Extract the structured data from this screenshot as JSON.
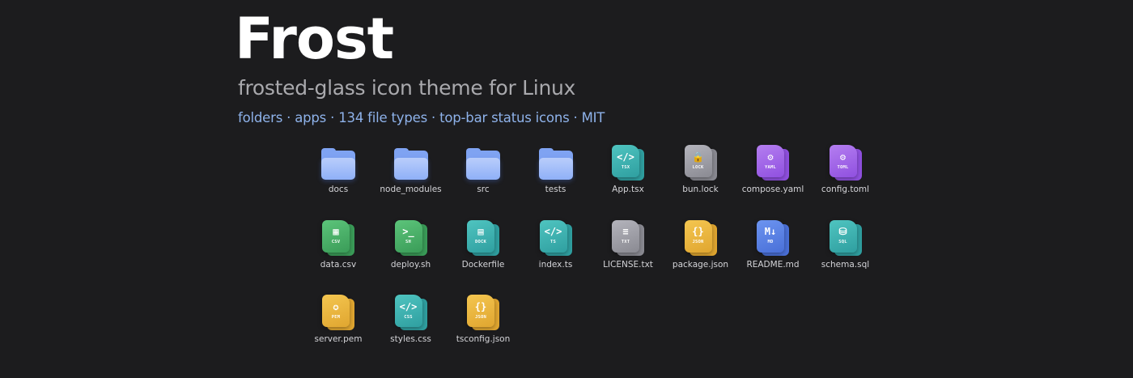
{
  "header": {
    "title": "Frost",
    "subtitle": "frosted-glass icon theme for Linux",
    "features": "folders · apps · 134 file types · top-bar status icons · MIT"
  },
  "items": [
    {
      "label": "docs",
      "kind": "folder",
      "icon": "folder-icon"
    },
    {
      "label": "node_modules",
      "kind": "folder",
      "icon": "folder-icon"
    },
    {
      "label": "src",
      "kind": "folder",
      "icon": "folder-icon"
    },
    {
      "label": "tests",
      "kind": "folder",
      "icon": "folder-icon"
    },
    {
      "label": "App.tsx",
      "kind": "file",
      "ext": "TSX",
      "glyph": "</>",
      "icon": "tsx-file-icon",
      "color": "#4fc4c0",
      "color2": "#2f9fa0"
    },
    {
      "label": "bun.lock",
      "kind": "file",
      "ext": "LOCK",
      "glyph": "🔒",
      "icon": "lock-file-icon",
      "color": "#b4b4bc",
      "color2": "#8a8a92"
    },
    {
      "label": "compose.yaml",
      "kind": "file",
      "ext": "YAML",
      "glyph": "⚙",
      "icon": "yaml-file-icon",
      "color": "#b47ef0",
      "color2": "#9050e0"
    },
    {
      "label": "config.toml",
      "kind": "file",
      "ext": "TOML",
      "glyph": "⚙",
      "icon": "toml-file-icon",
      "color": "#b47ef0",
      "color2": "#9050e0"
    },
    {
      "label": "data.csv",
      "kind": "file",
      "ext": "CSV",
      "glyph": "▦",
      "icon": "csv-file-icon",
      "color": "#5cc47a",
      "color2": "#3a9c58"
    },
    {
      "label": "deploy.sh",
      "kind": "file",
      "ext": "SH",
      "glyph": ">_",
      "icon": "shell-file-icon",
      "color": "#5cc47a",
      "color2": "#3a9c58"
    },
    {
      "label": "Dockerfile",
      "kind": "file",
      "ext": "DOCK",
      "glyph": "▤",
      "icon": "docker-file-icon",
      "color": "#4fc4c0",
      "color2": "#2f9fa0"
    },
    {
      "label": "index.ts",
      "kind": "file",
      "ext": "TS",
      "glyph": "</>",
      "icon": "ts-file-icon",
      "color": "#4fc4c0",
      "color2": "#2f9fa0"
    },
    {
      "label": "LICENSE.txt",
      "kind": "file",
      "ext": "TXT",
      "glyph": "≡",
      "icon": "text-file-icon",
      "color": "#b4b4bc",
      "color2": "#8a8a92"
    },
    {
      "label": "package.json",
      "kind": "file",
      "ext": "JSON",
      "glyph": "{}",
      "icon": "json-file-icon",
      "color": "#f4c650",
      "color2": "#e0a630"
    },
    {
      "label": "README.md",
      "kind": "file",
      "ext": "MD",
      "glyph": "M↓",
      "icon": "markdown-file-icon",
      "color": "#6c94f0",
      "color2": "#4a70d8"
    },
    {
      "label": "schema.sql",
      "kind": "file",
      "ext": "SQL",
      "glyph": "⛁",
      "icon": "sql-file-icon",
      "color": "#4fc4c0",
      "color2": "#2f9fa0"
    },
    {
      "label": "server.pem",
      "kind": "file",
      "ext": "PEM",
      "glyph": "✪",
      "icon": "certificate-file-icon",
      "color": "#f4c650",
      "color2": "#e0a630"
    },
    {
      "label": "styles.css",
      "kind": "file",
      "ext": "CSS",
      "glyph": "</>",
      "icon": "css-file-icon",
      "color": "#4fc4c0",
      "color2": "#2f9fa0"
    },
    {
      "label": "tsconfig.json",
      "kind": "file",
      "ext": "JSON",
      "glyph": "{}",
      "icon": "json-file-icon",
      "color": "#f4c650",
      "color2": "#e0a630"
    }
  ],
  "colors": {
    "background": "#1c1c1e",
    "accent": "#8eb2ea",
    "folder": "#8fb0f7"
  }
}
